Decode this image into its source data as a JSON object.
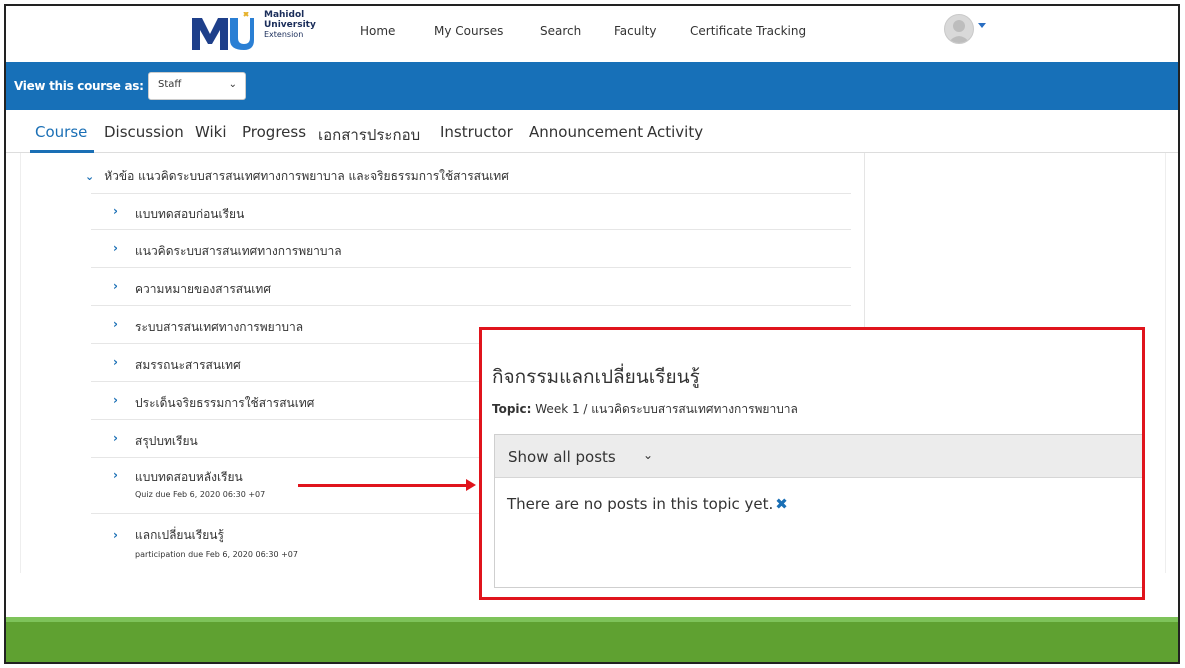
{
  "header": {
    "logo_line1": "Mahidol",
    "logo_line2": "University",
    "logo_line3": "Extension",
    "nav": [
      "Home",
      "My Courses",
      "Search",
      "Faculty",
      "Certificate Tracking"
    ]
  },
  "view_bar": {
    "label": "View this course as:",
    "select_value": "Staff"
  },
  "tabs": [
    "Course",
    "Discussion",
    "Wiki",
    "Progress",
    "เอกสารประกอบ",
    "Instructor",
    "Announcement",
    "Activity"
  ],
  "outline": {
    "section_title": "หัวข้อ แนวคิดระบบสารสนเทศทางการพยาบาล และจริยธรรมการใช้สารสนเทศ",
    "units": [
      {
        "title": "แบบทดสอบก่อนเรียน",
        "due": ""
      },
      {
        "title": "แนวคิดระบบสารสนเทศทางการพยาบาล",
        "due": ""
      },
      {
        "title": "ความหมายของสารสนเทศ",
        "due": ""
      },
      {
        "title": "ระบบสารสนเทศทางการพยาบาล",
        "due": ""
      },
      {
        "title": "สมรรถนะสารสนเทศ",
        "due": ""
      },
      {
        "title": "ประเด็นจริยธรรมการใช้สารสนเทศ",
        "due": ""
      },
      {
        "title": "สรุปบทเรียน",
        "due": ""
      },
      {
        "title": "แบบทดสอบหลังเรียน",
        "due": "Quiz due Feb 6, 2020 06:30 +07"
      },
      {
        "title": "แลกเปลี่ยนเรียนรู้",
        "due": "participation due Feb 6, 2020 06:30 +07"
      }
    ]
  },
  "popup": {
    "title": "กิจกรรมแลกเปลี่ยนเรียนรู้",
    "topic_label": "Topic:",
    "topic_value": " Week 1 / แนวคิดระบบสารสนเทศทางการพยาบาล",
    "filter_label": "Show all posts",
    "empty_message": "There are no posts in this topic yet."
  },
  "colors": {
    "accent": "#1a6fb5",
    "view_bar": "#1770b8",
    "highlight": "#e0141c",
    "footer": "#5fa131"
  }
}
